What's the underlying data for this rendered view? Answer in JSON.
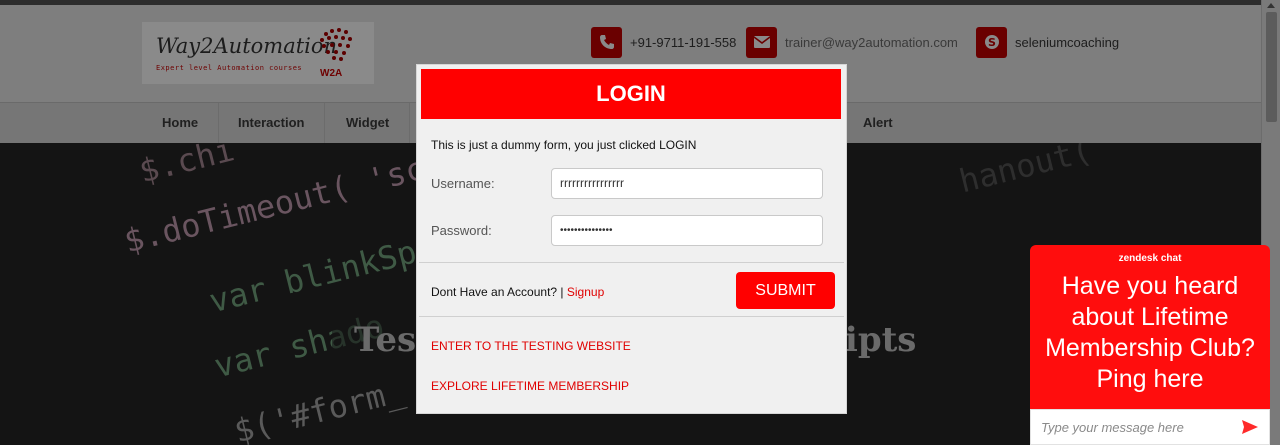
{
  "header": {
    "logo_title": "Way2Automation",
    "logo_subtitle": "Expert level Automation courses",
    "logo_mark_text": "W2A",
    "phone": "+91-9711-191-558",
    "email": "trainer@way2automation.com",
    "skype": "seleniumcoaching"
  },
  "nav": {
    "items": [
      "Home",
      "Interaction",
      "Widget",
      "Alert"
    ]
  },
  "hero": {
    "code_lines": [
      "$.chi",
      "$.doTimeout( 'scr",
      "var blinkSp",
      "var shado",
      "$('#form_",
      "hanout("
    ],
    "title": "Testing Automation Scripts",
    "title_left_visible": "Test",
    "title_right_visible": "ripts"
  },
  "login": {
    "title": "LOGIN",
    "note": "This is just a dummy form, you just clicked LOGIN",
    "username_label": "Username:",
    "username_value": "rrrrrrrrrrrrrrrr",
    "password_label": "Password:",
    "password_value": "•••••••••••••••",
    "account_text": "Dont Have an Account? |",
    "signup_link": "Signup",
    "submit_label": "SUBMIT",
    "enter_link": "ENTER TO THE TESTING WEBSITE",
    "membership_link": "EXPLORE LIFETIME MEMBERSHIP"
  },
  "chat": {
    "brand": "zendesk chat",
    "message": "Have you heard about Lifetime Membership Club? Ping here",
    "placeholder": "Type your message here"
  },
  "colors": {
    "brand_red": "#ff0000",
    "link_red": "#e00000",
    "overlay_gray": "#7e7e7e"
  },
  "icons": [
    "phone-icon",
    "mail-icon",
    "skype-icon",
    "send-icon"
  ]
}
